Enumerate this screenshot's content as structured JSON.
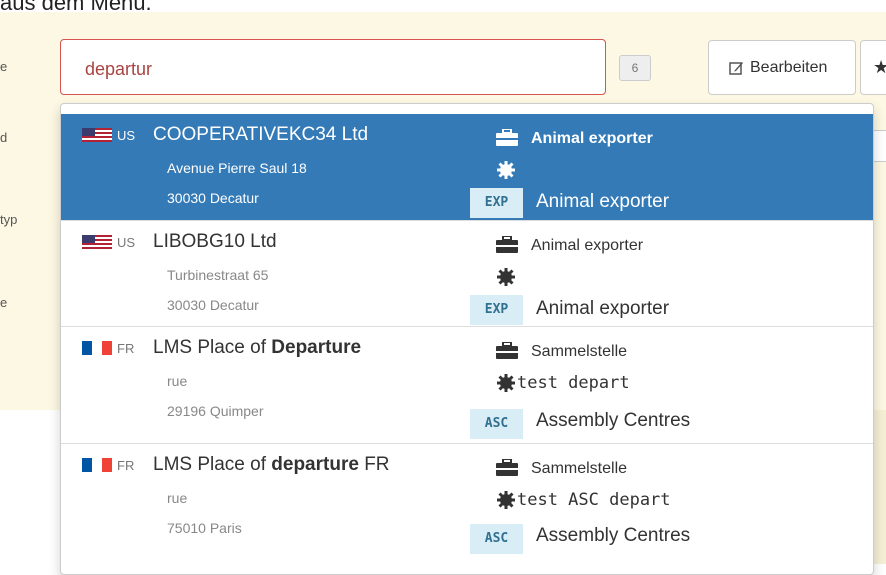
{
  "header_text": "aus dem Menü.",
  "side_labels": [
    "e",
    "d",
    "typ",
    "e"
  ],
  "search": {
    "value": "departur",
    "placeholder": ""
  },
  "count": "6",
  "toolbar": {
    "edit_label": "Bearbeiten"
  },
  "items": [
    {
      "country": "US",
      "flag": "us",
      "name_parts": [
        "COOPERATIVEKC34 Ltd"
      ],
      "street": "Avenue Pierre Saul 18",
      "city": "30030 Decatur",
      "role": "Animal exporter",
      "detail": "",
      "type_code": "EXP",
      "type_label": "Animal exporter",
      "active": true
    },
    {
      "country": "US",
      "flag": "us",
      "name_parts": [
        "LIBOBG10 Ltd"
      ],
      "street": "Turbinestraat 65",
      "city": "30030 Decatur",
      "role": "Animal exporter",
      "detail": "",
      "type_code": "EXP",
      "type_label": "Animal exporter",
      "active": false
    },
    {
      "country": "FR",
      "flag": "fr",
      "name_parts": [
        "LMS Place of ",
        "Departure",
        ""
      ],
      "street": "rue",
      "city": "29196 Quimper",
      "role": "Sammelstelle",
      "detail": "test depart",
      "type_code": "ASC",
      "type_label": "Assembly Centres",
      "active": false
    },
    {
      "country": "FR",
      "flag": "fr",
      "name_parts": [
        "LMS Place of ",
        "departure",
        " FR"
      ],
      "street": "rue",
      "city": "75010 Paris",
      "role": "Sammelstelle",
      "detail": "test ASC depart",
      "type_code": "ASC",
      "type_label": "Assembly Centres",
      "active": false
    }
  ],
  "colors": {
    "active_bg": "#337ab7",
    "error_border": "#d9534f",
    "panel_bg": "#fcf8e3",
    "badge_bg": "#d9edf7"
  }
}
